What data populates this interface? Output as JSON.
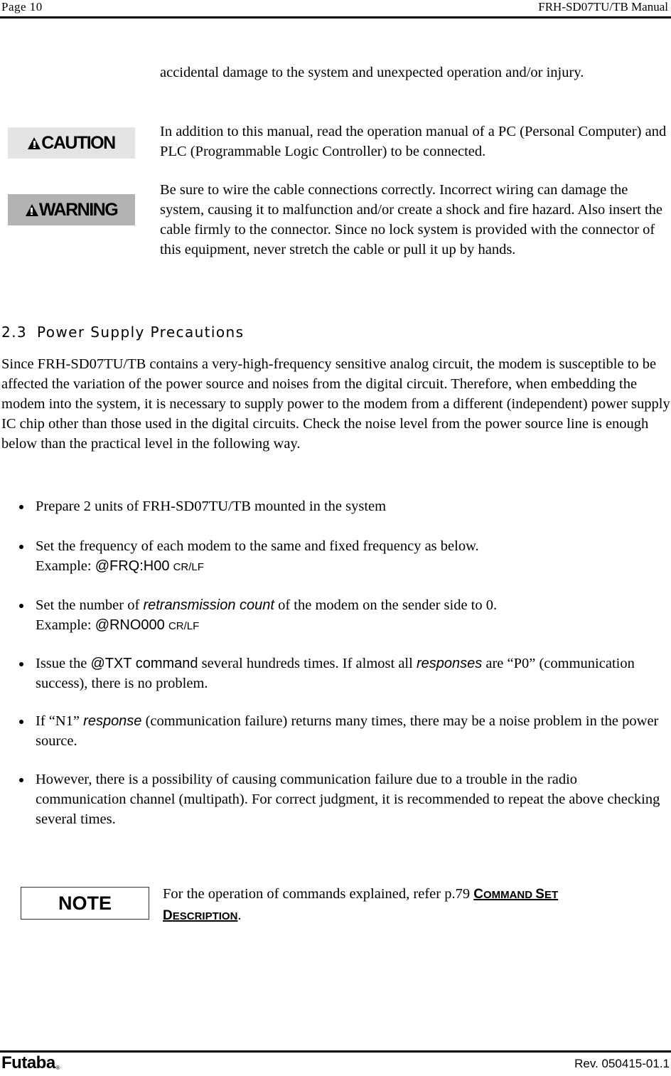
{
  "header": {
    "page_label": "Page  10",
    "manual_title": "FRH-SD07TU/TB Manual"
  },
  "badges": {
    "caution": "CAUTION",
    "warning": "WARNING",
    "note": "NOTE"
  },
  "precautions": {
    "p1": "accidental damage to the system and unexpected operation and/or injury.",
    "p2": "In addition to this manual, read the operation manual of a PC (Personal Computer) and PLC (Programmable Logic Controller) to be connected.",
    "p3": "Be sure to wire the cable connections correctly. Incorrect wiring can damage the system, causing it to malfunction and/or create a shock and fire hazard. Also insert the cable firmly to the connector. Since no lock system is provided with the connector of this equipment, never stretch the cable or pull it up by hands."
  },
  "section": {
    "number": "2.3",
    "title": "Power Supply Precautions",
    "body": "Since FRH-SD07TU/TB contains a very-high-frequency sensitive analog circuit, the modem is susceptible to be affected the variation of the power source and noises from the digital circuit. Therefore, when embedding the modem into the system, it is necessary to supply power to the modem from a different (independent) power supply IC chip other than those used in the digital circuits. Check the noise level from the power source line is enough below than the practical level in the following way."
  },
  "bullets": {
    "b1": {
      "text": "Prepare 2 units of FRH-SD07TU/TB mounted in the system"
    },
    "b2": {
      "text": "Set the frequency of each modem to the same and fixed frequency as below.",
      "example_label": "Example: ",
      "command": "@FRQ:H00",
      "suffix": "CR/LF"
    },
    "b3": {
      "pre": "Set the number of ",
      "term": "retransmission count",
      "post": " of the modem on the sender side to 0.",
      "example_label": "Example: ",
      "command": "@RNO000",
      "suffix": "CR/LF"
    },
    "b4": {
      "pre": "Issue the ",
      "command": "@TXT command",
      "mid": " several hundreds times. If almost all ",
      "term": "responses",
      "post": " are “P0” (communication success), there is no problem."
    },
    "b5": {
      "pre": "If “N1” ",
      "term": "response",
      "post": " (communication failure) returns many times, there may be a noise problem in the power source."
    },
    "b6": {
      "text": "However, there is a possibility of causing communication failure due to a trouble in the radio communication channel (multipath). For correct judgment, it is recommended to repeat the above checking several times."
    }
  },
  "note": {
    "text": "For the operation of commands explained, refer p.79 ",
    "link_c1": "C",
    "link_w1": "OMMAND ",
    "link_c2": "S",
    "link_w2": "ET",
    "link_c3": "D",
    "link_w3": "ESCRIPTION",
    "end": "."
  },
  "footer": {
    "logo": "Futaba",
    "reg": "®",
    "revision": "Rev. 050415-01.1"
  }
}
